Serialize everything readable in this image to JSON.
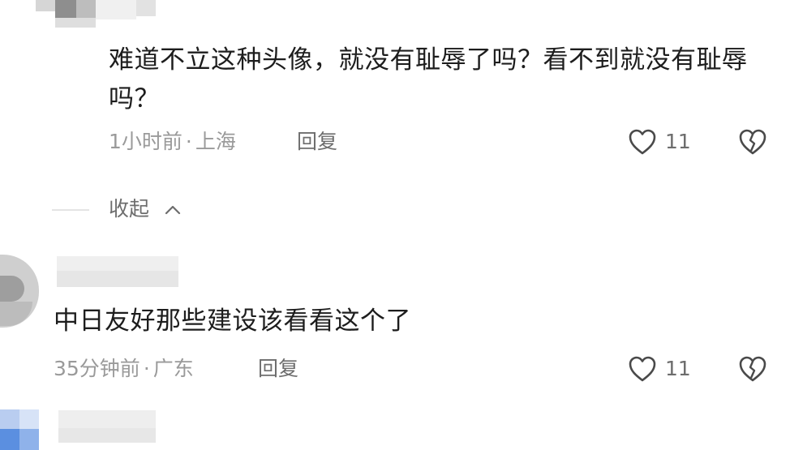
{
  "comments": [
    {
      "text": "难道不立这种头像，就没有耻辱了吗？看不到就没有耻辱吗？",
      "time": "1小时前",
      "location": "上海",
      "reply_label": "回复",
      "like_count": "11",
      "like_icon": "heart-outline-icon",
      "dislike_icon": "broken-heart-icon"
    },
    {
      "text": "中日友好那些建设该看看这个了",
      "time": "35分钟前",
      "location": "广东",
      "reply_label": "回复",
      "like_count": "11",
      "like_icon": "heart-outline-icon",
      "dislike_icon": "broken-heart-icon"
    }
  ],
  "collapse": {
    "label": "收起",
    "icon": "chevron-up-icon"
  },
  "separator": "·"
}
